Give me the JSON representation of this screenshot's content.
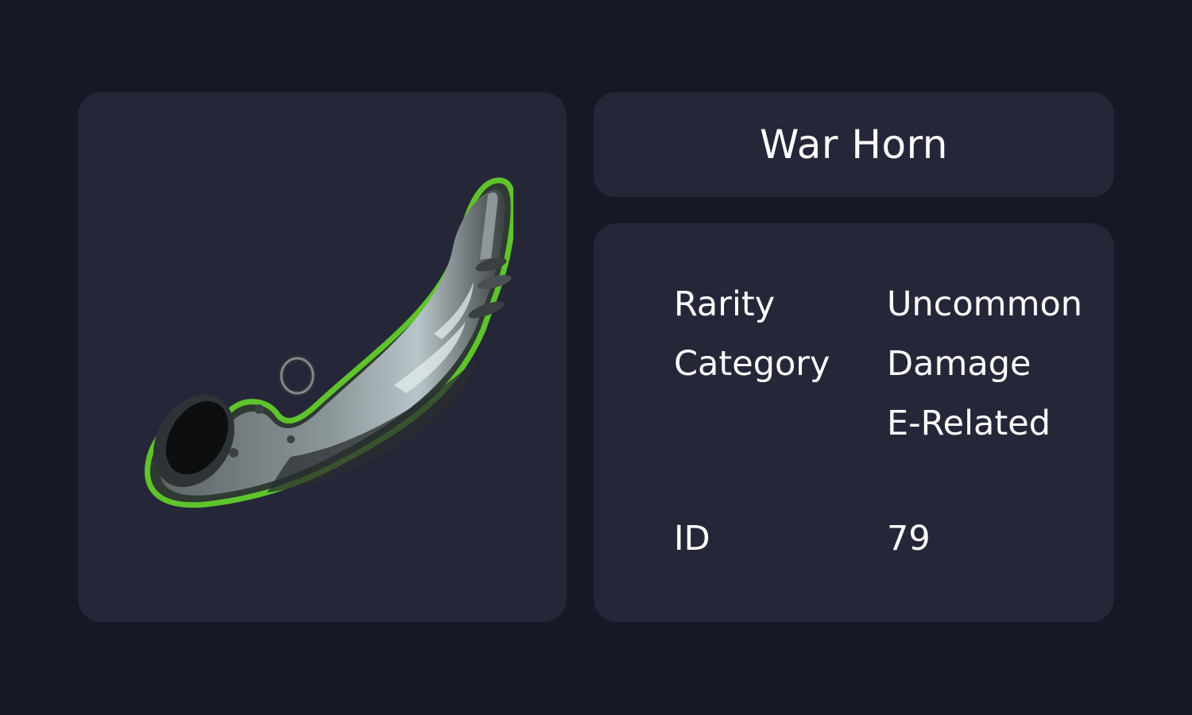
{
  "item": {
    "name": "War Horn",
    "image_icon": "war-horn-icon",
    "outline_color": "#5fc42b"
  },
  "details": {
    "rarity_label": "Rarity",
    "rarity_value": "Uncommon",
    "category_label": "Category",
    "category_values": [
      "Damage",
      "E-Related"
    ],
    "id_label": "ID",
    "id_value": "79"
  },
  "colors": {
    "background": "#171826",
    "card": "#252739",
    "text": "#ffffff"
  }
}
